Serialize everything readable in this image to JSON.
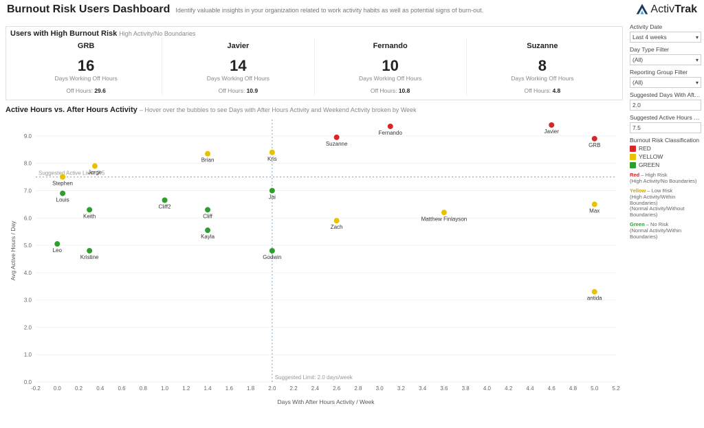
{
  "header": {
    "title": "Burnout Risk Users Dashboard",
    "subtitle": "Identify valuable insights in your organization related to work activity habits as well as potential signs of burn-out.",
    "logo_text_1": "Activ",
    "logo_text_2": "Trak"
  },
  "section1": {
    "title": "Users with High Burnout Risk",
    "sub": "High Activity/No Boundaries",
    "cards": [
      {
        "name": "GRB",
        "days": "16",
        "days_label": "Days Working Off Hours",
        "off_label": "Off Hours:",
        "off_hours": "29.6"
      },
      {
        "name": "Javier",
        "days": "14",
        "days_label": "Days Working Off Hours",
        "off_label": "Off Hours:",
        "off_hours": "10.9"
      },
      {
        "name": "Fernando",
        "days": "10",
        "days_label": "Days Working Off Hours",
        "off_label": "Off Hours:",
        "off_hours": "10.8"
      },
      {
        "name": "Suzanne",
        "days": "8",
        "days_label": "Days Working Off Hours",
        "off_label": "Off Hours:",
        "off_hours": "4.8"
      }
    ]
  },
  "section2": {
    "title": "Active Hours vs. After Hours Activity",
    "sub": " – Hover over the bubbles to see Days with After Hours Activity and Weekend Activity broken by Week"
  },
  "sidebar": {
    "activity_date_label": "Activity Date",
    "activity_date_value": "Last 4 weeks",
    "day_type_label": "Day Type Filter",
    "day_type_value": "(All)",
    "reporting_group_label": "Reporting Group Filter",
    "reporting_group_value": "(All)",
    "sugg_days_label": "Suggested Days With After Ho…",
    "sugg_days_value": "2.0",
    "sugg_hours_label": "Suggested Active Hours Limit",
    "sugg_hours_value": "7.5",
    "classification_title": "Burnout Risk Classification",
    "legend": [
      {
        "color": "#d62828",
        "label": "RED"
      },
      {
        "color": "#e8c100",
        "label": "YELLOW"
      },
      {
        "color": "#2e9e2e",
        "label": "GREEN"
      }
    ],
    "risk_red_title": "Red",
    "risk_red_sub": " – High Risk",
    "risk_red_desc": "(High Activity/No Boundaries)",
    "risk_yellow_title": "Yellow",
    "risk_yellow_sub": " – Low Risk",
    "risk_yellow_desc": "(High Activity/Within Boundaries)\n(Normal Activity/Without Boundaries)",
    "risk_green_title": "Green",
    "risk_green_sub": " – No Risk",
    "risk_green_desc": "(Normal Activity/Within Boundaries)"
  },
  "chart_data": {
    "type": "scatter",
    "xlabel": "Days With After Hours Activity / Week",
    "ylabel": "Avg Active Hours / Day",
    "xlim": [
      -0.2,
      5.2
    ],
    "ylim": [
      0.0,
      9.6
    ],
    "x_ticks": [
      -0.2,
      0.0,
      0.2,
      0.4,
      0.6,
      0.8,
      1.0,
      1.2,
      1.4,
      1.6,
      1.8,
      2.0,
      2.2,
      2.4,
      2.6,
      2.8,
      3.0,
      3.2,
      3.4,
      3.6,
      3.8,
      4.0,
      4.2,
      4.4,
      4.6,
      4.8,
      5.0,
      5.2
    ],
    "y_ticks": [
      0.0,
      1.0,
      2.0,
      3.0,
      4.0,
      5.0,
      6.0,
      7.0,
      8.0,
      9.0
    ],
    "ref_x": 2.0,
    "ref_y": 7.5,
    "ref_x_label": "Suggested Limit: 2.0 days/week",
    "ref_y_label": "Suggested Active Limit: 7.5",
    "series": [
      {
        "name": "RED",
        "color": "#d62828",
        "points": [
          {
            "label": "Suzanne",
            "x": 2.6,
            "y": 8.95
          },
          {
            "label": "Fernando",
            "x": 3.1,
            "y": 9.35
          },
          {
            "label": "Javier",
            "x": 4.6,
            "y": 9.4
          },
          {
            "label": "GRB",
            "x": 5.0,
            "y": 8.9
          }
        ]
      },
      {
        "name": "YELLOW",
        "color": "#e8c100",
        "points": [
          {
            "label": "Stephen",
            "x": 0.05,
            "y": 7.5
          },
          {
            "label": "Jorge",
            "x": 0.35,
            "y": 7.9
          },
          {
            "label": "Brian",
            "x": 1.4,
            "y": 8.35
          },
          {
            "label": "Kris",
            "x": 2.0,
            "y": 8.4
          },
          {
            "label": "Zach",
            "x": 2.6,
            "y": 5.9
          },
          {
            "label": "Matthew Finlayson",
            "x": 3.6,
            "y": 6.2
          },
          {
            "label": "Max",
            "x": 5.0,
            "y": 6.5
          },
          {
            "label": "antida",
            "x": 5.0,
            "y": 3.3
          }
        ]
      },
      {
        "name": "GREEN",
        "color": "#2e9e2e",
        "points": [
          {
            "label": "Louis",
            "x": 0.05,
            "y": 6.9
          },
          {
            "label": "Leo",
            "x": 0.0,
            "y": 5.05
          },
          {
            "label": "Keith",
            "x": 0.3,
            "y": 6.3
          },
          {
            "label": "Kristine",
            "x": 0.3,
            "y": 4.8
          },
          {
            "label": "Cliff2",
            "x": 1.0,
            "y": 6.65
          },
          {
            "label": "Cliff",
            "x": 1.4,
            "y": 6.3
          },
          {
            "label": "Kayla",
            "x": 1.4,
            "y": 5.55
          },
          {
            "label": "Jai",
            "x": 2.0,
            "y": 7.0
          },
          {
            "label": "Godwin",
            "x": 2.0,
            "y": 4.8
          }
        ]
      }
    ]
  }
}
